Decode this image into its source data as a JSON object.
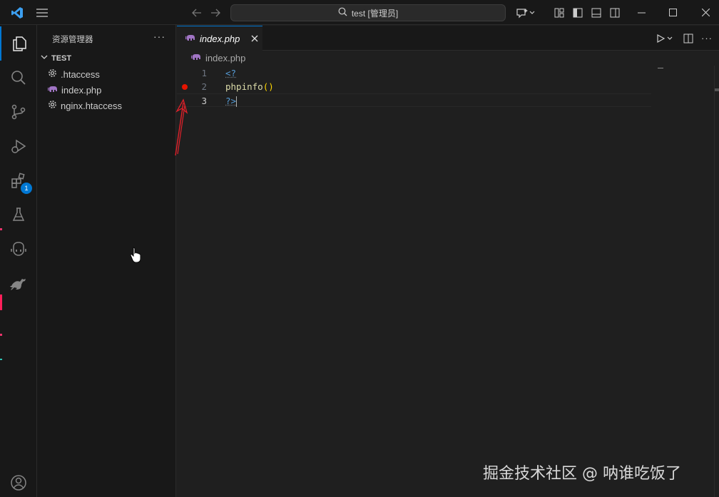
{
  "titlebar": {
    "search_text": "test [管理员]",
    "icons": [
      "vscode-logo",
      "menu-icon",
      "back-arrow-icon",
      "forward-arrow-icon",
      "search-icon",
      "copilot-icon",
      "layout-customize-icon",
      "toggle-primary-sidebar-icon",
      "toggle-panel-icon",
      "toggle-secondary-sidebar-icon",
      "minimize-icon",
      "maximize-icon",
      "close-icon"
    ]
  },
  "activitybar": {
    "items": [
      "explorer-icon",
      "search-icon",
      "source-control-icon",
      "run-debug-icon",
      "extensions-icon",
      "testing-icon",
      "copilot-icon",
      "kangaroo-icon"
    ],
    "extensions_badge": "1",
    "bottom": [
      "account-icon"
    ]
  },
  "sidebar": {
    "title": "资源管理器",
    "more": "···",
    "section": "TEST",
    "files": [
      {
        "name": ".htaccess",
        "icon": "gear-icon"
      },
      {
        "name": "index.php",
        "icon": "php-elephant-icon"
      },
      {
        "name": "nginx.htaccess",
        "icon": "gear-icon"
      }
    ]
  },
  "editor": {
    "tab_label": "index.php",
    "breadcrumb": "index.php",
    "lines": [
      {
        "number": "1",
        "tokens": [
          "<?"
        ]
      },
      {
        "number": "2",
        "tokens": [
          "phpinfo",
          "()"
        ],
        "breakpoint": true
      },
      {
        "number": "3",
        "tokens": [
          "?>"
        ],
        "current": true
      }
    ]
  },
  "watermark": "掘金技术社区 @ 呐谁吃饭了",
  "colors": {
    "accent": "#0078d4",
    "breakpoint": "#e51400",
    "annotation_arrow": "#e0202a",
    "keyword": "#569cd6",
    "function": "#dcdcaa"
  }
}
